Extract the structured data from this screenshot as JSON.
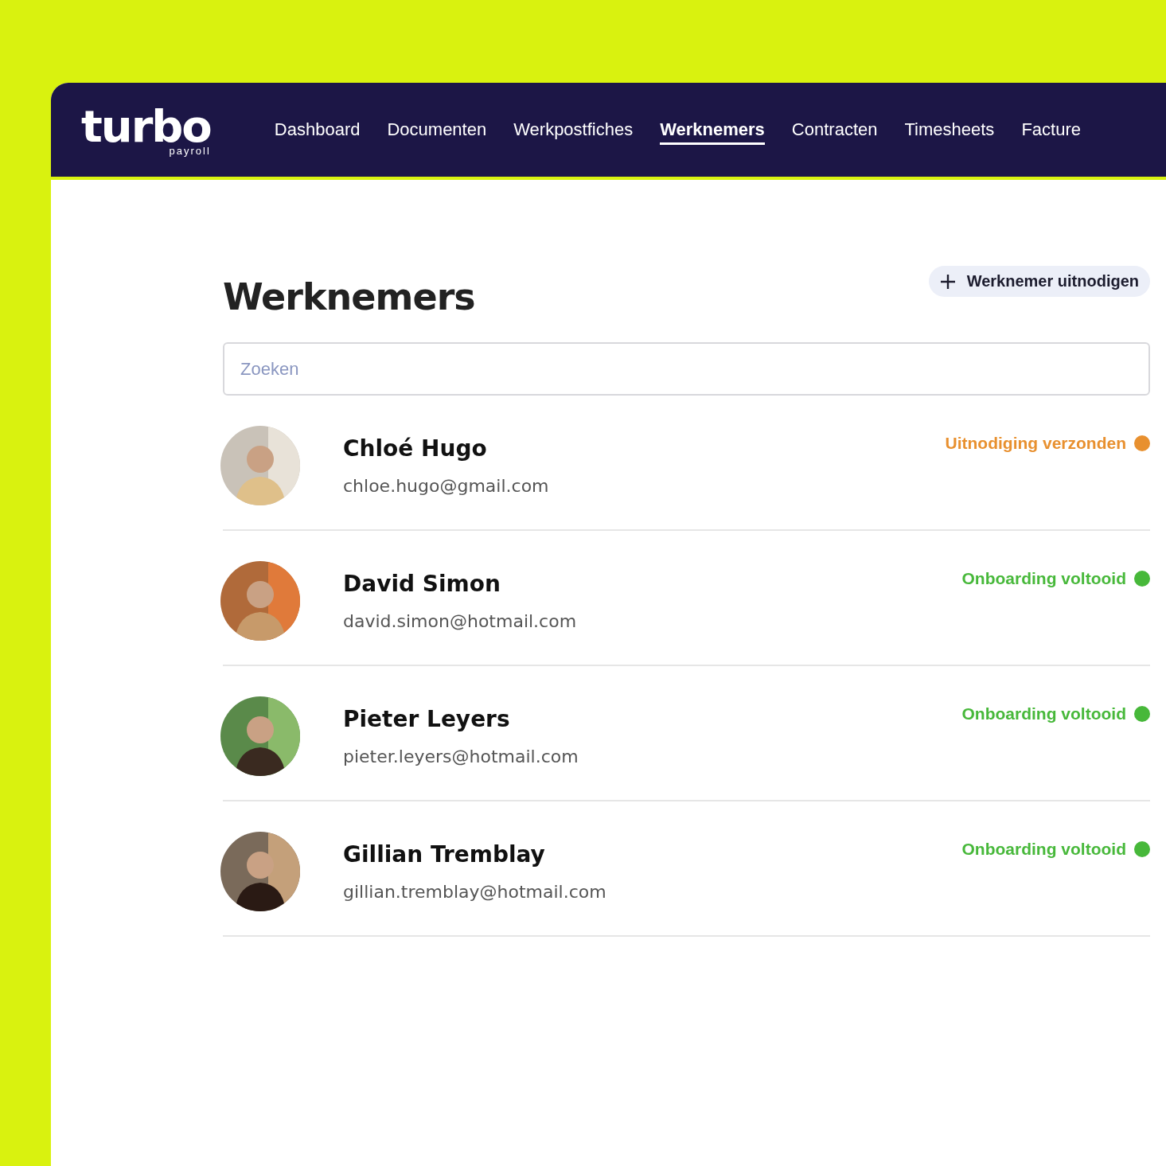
{
  "logo": {
    "name": "turbo",
    "tagline": "payroll"
  },
  "nav": [
    {
      "label": "Dashboard",
      "selected": false
    },
    {
      "label": "Documenten",
      "selected": false
    },
    {
      "label": "Werkpostfiches",
      "selected": false
    },
    {
      "label": "Werknemers",
      "selected": true
    },
    {
      "label": "Contracten",
      "selected": false
    },
    {
      "label": "Timesheets",
      "selected": false
    },
    {
      "label": "Facture",
      "selected": false
    }
  ],
  "title": "Werknemers",
  "invite_button": {
    "label": "Werknemer uitnodigen"
  },
  "search": {
    "placeholder": "Zoeken"
  },
  "employees": [
    {
      "name": "Chloé Hugo",
      "email": "chloe.hugo@gmail.com",
      "status": {
        "label": "Uitnodiging verzonden",
        "color": "#e8902f"
      }
    },
    {
      "name": "David Simon",
      "email": "david.simon@hotmail.com",
      "status": {
        "label": "Onboarding voltooid",
        "color": "#47b83a"
      }
    },
    {
      "name": "Pieter Leyers",
      "email": "pieter.leyers@hotmail.com",
      "status": {
        "label": "Onboarding voltooid",
        "color": "#47b83a"
      }
    },
    {
      "name": "Gillian Tremblay",
      "email": "gillian.tremblay@hotmail.com",
      "status": {
        "label": "Onboarding voltooid",
        "color": "#47b83a"
      }
    }
  ]
}
